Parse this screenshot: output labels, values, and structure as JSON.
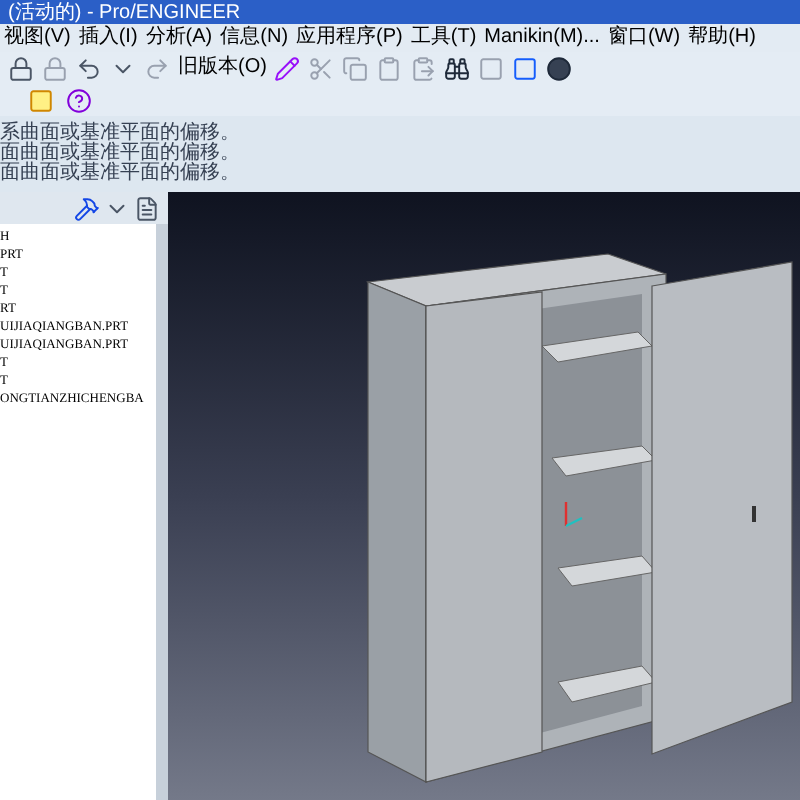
{
  "window": {
    "title": "(活动的) - Pro/ENGINEER"
  },
  "menu": [
    "视图(V)",
    "插入(I)",
    "分析(A)",
    "信息(N)",
    "应用程序(P)",
    "工具(T)",
    "Manikin(M)...",
    "窗口(W)",
    "帮助(H)"
  ],
  "toolbar": {
    "old_version": "旧版本(O)"
  },
  "messages": [
    "系曲面或基准平面的偏移。",
    "面曲面或基准平面的偏移。",
    "面曲面或基准平面的偏移。"
  ],
  "model_tree": {
    "items": [
      {
        "label": "H"
      },
      {
        "label": "PRT"
      },
      {
        "label": "T"
      },
      {
        "label": "T"
      },
      {
        "label": "RT"
      },
      {
        "label": "UIJIAQIANGBAN.PRT"
      },
      {
        "label": "UIJIAQIANGBAN.PRT"
      },
      {
        "label": "T"
      },
      {
        "label": "T"
      },
      {
        "label": "ONGTIANZHICHENGBA"
      }
    ]
  }
}
